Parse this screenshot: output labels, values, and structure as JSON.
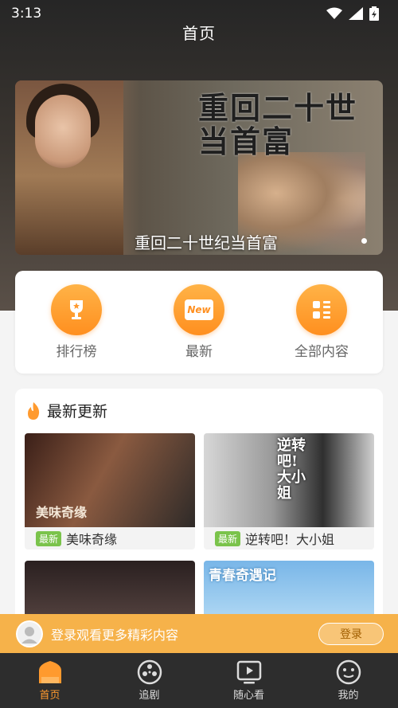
{
  "status": {
    "time": "3:13"
  },
  "header": {
    "title": "首页"
  },
  "banner": {
    "poster_title_line1": "重回二十世",
    "poster_title_line2": "当首富",
    "caption": "重回二十世纪当首富"
  },
  "quick": [
    {
      "label": "排行榜",
      "icon": "trophy-icon"
    },
    {
      "label": "最新",
      "icon": "new-icon",
      "icon_text": "New"
    },
    {
      "label": "全部内容",
      "icon": "grid-icon"
    }
  ],
  "latest": {
    "title": "最新更新",
    "items": [
      {
        "badge": "最新",
        "title": "美味奇缘",
        "thumb_text": "美味奇缘"
      },
      {
        "badge": "最新",
        "title": "逆转吧！大小姐",
        "thumb_text": "逆转吧!大小姐"
      },
      {
        "badge": "",
        "title": "",
        "thumb_text": ""
      },
      {
        "badge": "",
        "title": "",
        "thumb_text": "青春奇遇记"
      }
    ]
  },
  "login": {
    "prompt": "登录观看更多精彩内容",
    "button": "登录"
  },
  "nav": [
    {
      "label": "首页",
      "icon": "home-icon",
      "active": true
    },
    {
      "label": "追剧",
      "icon": "film-reel-icon",
      "active": false
    },
    {
      "label": "随心看",
      "icon": "play-icon",
      "active": false
    },
    {
      "label": "我的",
      "icon": "profile-icon",
      "active": false
    }
  ],
  "colors": {
    "accent": "#ff9a2e",
    "badge": "#7ac34b",
    "login_bar": "#f6b24a"
  }
}
